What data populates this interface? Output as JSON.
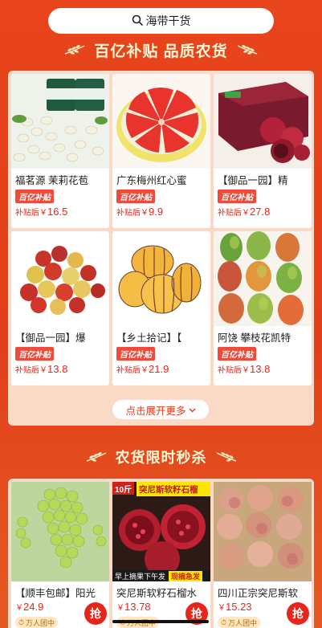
{
  "search": {
    "text": "海带干货",
    "icon": "search-icon"
  },
  "banner": {
    "title": "百亿补贴 品质农货"
  },
  "products": [
    {
      "name": "福茗源 茉莉花苞",
      "badge": "百亿补贴",
      "price_prefix": "补贴后￥",
      "price": "16.5",
      "image": "jasmine-tea-jars"
    },
    {
      "name": "广东梅州红心蜜",
      "badge": "百亿补贴",
      "price_prefix": "补贴后￥",
      "price": "9.9",
      "image": "red-pomelo"
    },
    {
      "name": "【御品一园】精",
      "badge": "百亿补贴",
      "price_prefix": "补贴后￥",
      "price": "27.8",
      "image": "pomegranate-box"
    },
    {
      "name": "【御品一园】爆",
      "badge": "百亿补贴",
      "price_prefix": "补贴后￥",
      "price": "13.8",
      "image": "winter-jujube"
    },
    {
      "name": "【乡土拾记】【",
      "badge": "百亿补贴",
      "price_prefix": "补贴后￥",
      "price": "21.9",
      "image": "pepino-melon"
    },
    {
      "name": "阿饶 攀枝花凯特",
      "badge": "百亿补贴",
      "price_prefix": "补贴后￥",
      "price": "13.8",
      "image": "mangoes"
    }
  ],
  "more_button": "点击展开更多",
  "seckill": {
    "title": "农货限时秒杀",
    "items": [
      {
        "name": "【顺丰包邮】阳光",
        "price_prefix": "￥",
        "price": "24.9",
        "group": "万人团中",
        "grab": "抢",
        "image": "green-grapes"
      },
      {
        "name": "突尼斯软籽石榴水",
        "price_prefix": "￥",
        "price": "13.78",
        "group": "万人团中",
        "grab": "抢",
        "image": "tunisia-pomegranate",
        "tag": "10斤",
        "tag_title": "突尼斯软籽石榴",
        "overlay_text": "早上摘果下午发",
        "overlay_highlight": "现摘急发"
      },
      {
        "name": "四川正宗突尼斯软",
        "price_prefix": "￥",
        "price": "15.23",
        "group": "万人团中",
        "grab": "抢",
        "image": "sichuan-pomegranates"
      }
    ]
  },
  "colors": {
    "primary_red": "#e8451c",
    "price_red": "#e8251b",
    "panel_bg": "#fbd9c7",
    "banner_text": "#fff7d6"
  }
}
